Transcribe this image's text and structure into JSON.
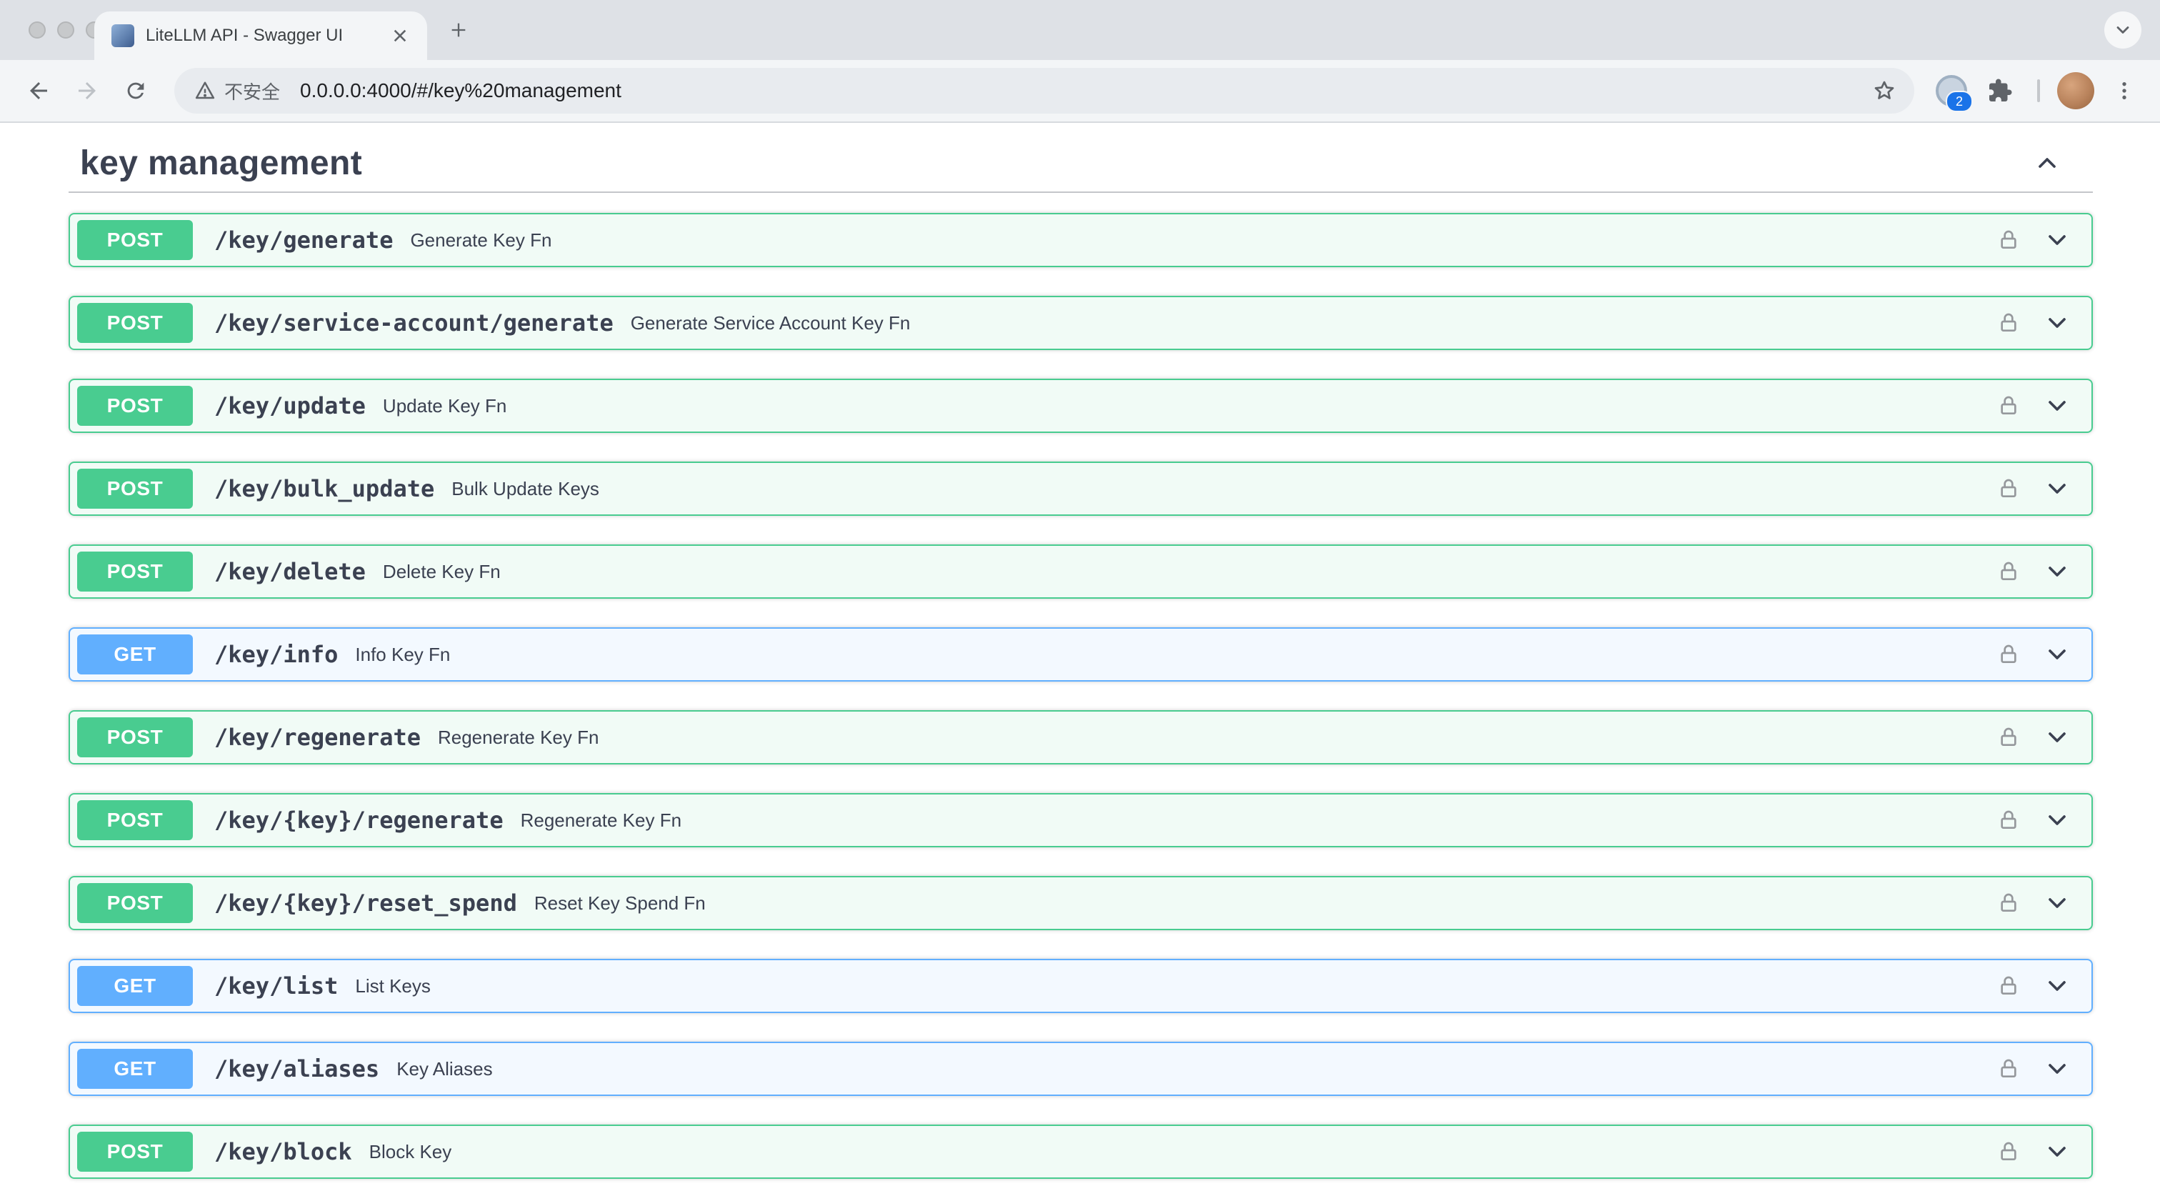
{
  "browser": {
    "tab_title": "LiteLLM API - Swagger UI",
    "url": "0.0.0.0:4000/#/key%20management",
    "security_label": "不安全",
    "extensions_badge_count": "2",
    "icons": {
      "security": "warning-triangle",
      "bookmark": "star-outline",
      "extensions": "puzzle-piece",
      "menu": "kebab-dots",
      "tab_search": "chevron-down"
    }
  },
  "page": {
    "section_title": "key management",
    "icons": {
      "endpoint_auth": "lock",
      "expand_row": "chevron-down",
      "collapse_section": "chevron-up"
    },
    "colors": {
      "post": "#49cc90",
      "post_bg": "rgba(73,204,144,0.08)",
      "get": "#61affe",
      "get_bg": "rgba(97,175,254,0.08)",
      "text": "#3b4151"
    },
    "endpoints": [
      {
        "method": "POST",
        "path": "/key/generate",
        "summary": "Generate Key Fn"
      },
      {
        "method": "POST",
        "path": "/key/service-account/generate",
        "summary": "Generate Service Account Key Fn"
      },
      {
        "method": "POST",
        "path": "/key/update",
        "summary": "Update Key Fn"
      },
      {
        "method": "POST",
        "path": "/key/bulk_update",
        "summary": "Bulk Update Keys"
      },
      {
        "method": "POST",
        "path": "/key/delete",
        "summary": "Delete Key Fn"
      },
      {
        "method": "GET",
        "path": "/key/info",
        "summary": "Info Key Fn"
      },
      {
        "method": "POST",
        "path": "/key/regenerate",
        "summary": "Regenerate Key Fn"
      },
      {
        "method": "POST",
        "path": "/key/{key}/regenerate",
        "summary": "Regenerate Key Fn"
      },
      {
        "method": "POST",
        "path": "/key/{key}/reset_spend",
        "summary": "Reset Key Spend Fn"
      },
      {
        "method": "GET",
        "path": "/key/list",
        "summary": "List Keys"
      },
      {
        "method": "GET",
        "path": "/key/aliases",
        "summary": "Key Aliases"
      },
      {
        "method": "POST",
        "path": "/key/block",
        "summary": "Block Key"
      }
    ]
  }
}
